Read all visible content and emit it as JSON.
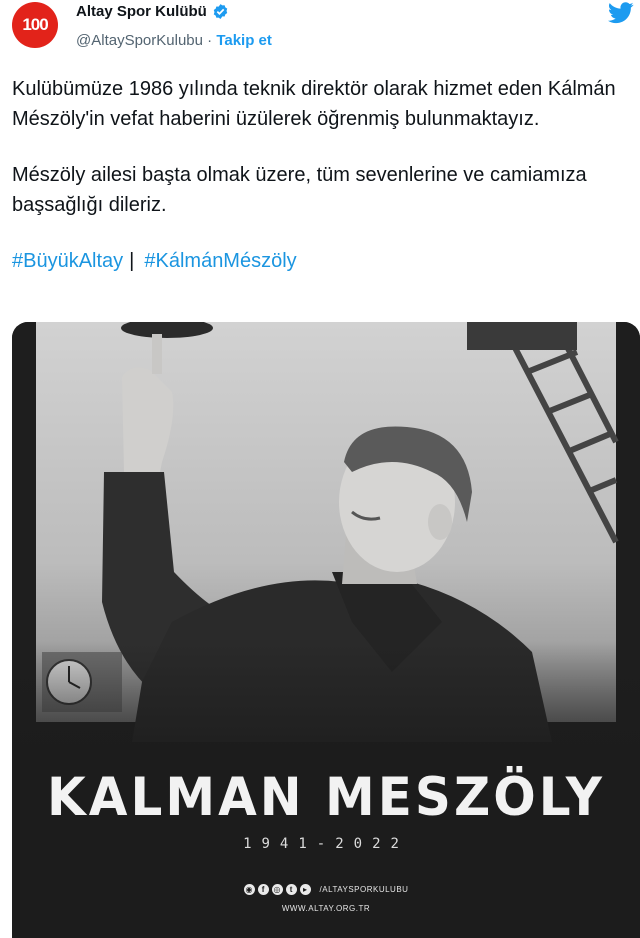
{
  "account": {
    "avatar_text": "100",
    "display_name": "Altay Spor Kulübü",
    "handle": "@AltaySporKulubu",
    "separator": " · ",
    "follow_label": "Takip et",
    "verified_icon": "verified-badge-icon",
    "platform_icon": "twitter-bird-icon"
  },
  "tweet": {
    "paragraph1": "Kulübümüze 1986 yılında teknik direktör olarak hizmet eden Kálmán Mészöly'in vefat haberini üzülerek öğrenmiş bulunmaktayız.",
    "paragraph2": "Mészöly ailesi başta olmak üzere, tüm sevenlerine ve camiamıza başsağlığı dileriz.",
    "hashtag1": "#BüyükAltay",
    "hashtag_separator": "|",
    "hashtag2": "#KálmánMészöly"
  },
  "media": {
    "title": "KALMAN MESZÖLY",
    "years": "1941-2022",
    "social_handle": "/ALTAYSPORKULUBU",
    "website": "WWW.ALTAY.ORG.TR"
  },
  "colors": {
    "accent": "#1d9bf0",
    "brand_red": "#e2231a",
    "text": "#0f1419",
    "muted": "#536471"
  }
}
